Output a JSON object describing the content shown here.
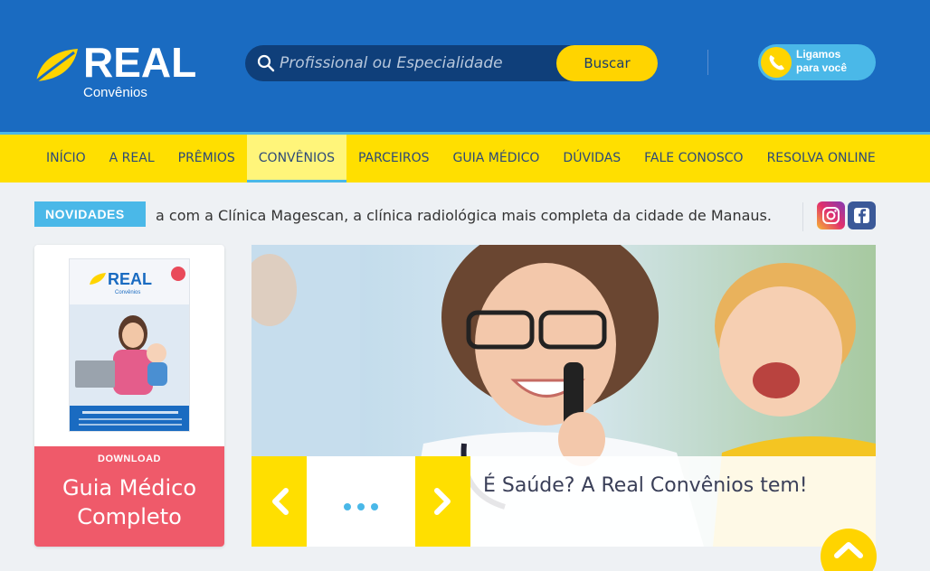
{
  "brand": {
    "name": "REAL",
    "subtitle": "Convênios",
    "colors": {
      "primary_blue": "#1a6bc1",
      "yellow": "#ffdf00",
      "light_blue": "#4ab8e8",
      "coral": "#ef5a6a"
    }
  },
  "search": {
    "placeholder": "Profissional ou Especialidade",
    "button_label": "Buscar",
    "icon": "search-icon"
  },
  "callback": {
    "line1": "Ligamos",
    "line2": "para você",
    "icon": "phone-icon"
  },
  "nav": {
    "items": [
      {
        "label": "INÍCIO"
      },
      {
        "label": "A REAL"
      },
      {
        "label": "PRÊMIOS"
      },
      {
        "label": "CONVÊNIOS",
        "active": true
      },
      {
        "label": "PARCEIROS"
      },
      {
        "label": "GUIA MÉDICO"
      },
      {
        "label": "DÚVIDAS"
      },
      {
        "label": "FALE CONOSCO"
      },
      {
        "label": "RESOLVA ONLINE"
      }
    ]
  },
  "news": {
    "badge": "NOVIDADES",
    "ticker": "a com a Clínica Magescan, a clínica radiológica mais completa da cidade de Manaus."
  },
  "social": {
    "icons": [
      "instagram-icon",
      "facebook-icon"
    ]
  },
  "guide": {
    "download_label": "DOWNLOAD",
    "title_line1": "Guia Médico",
    "title_line2": "Completo",
    "cover_brand": "REAL",
    "cover_sub": "Convênios"
  },
  "hero": {
    "caption": "É Saúde? A Real Convênios tem!",
    "dots": 3
  }
}
